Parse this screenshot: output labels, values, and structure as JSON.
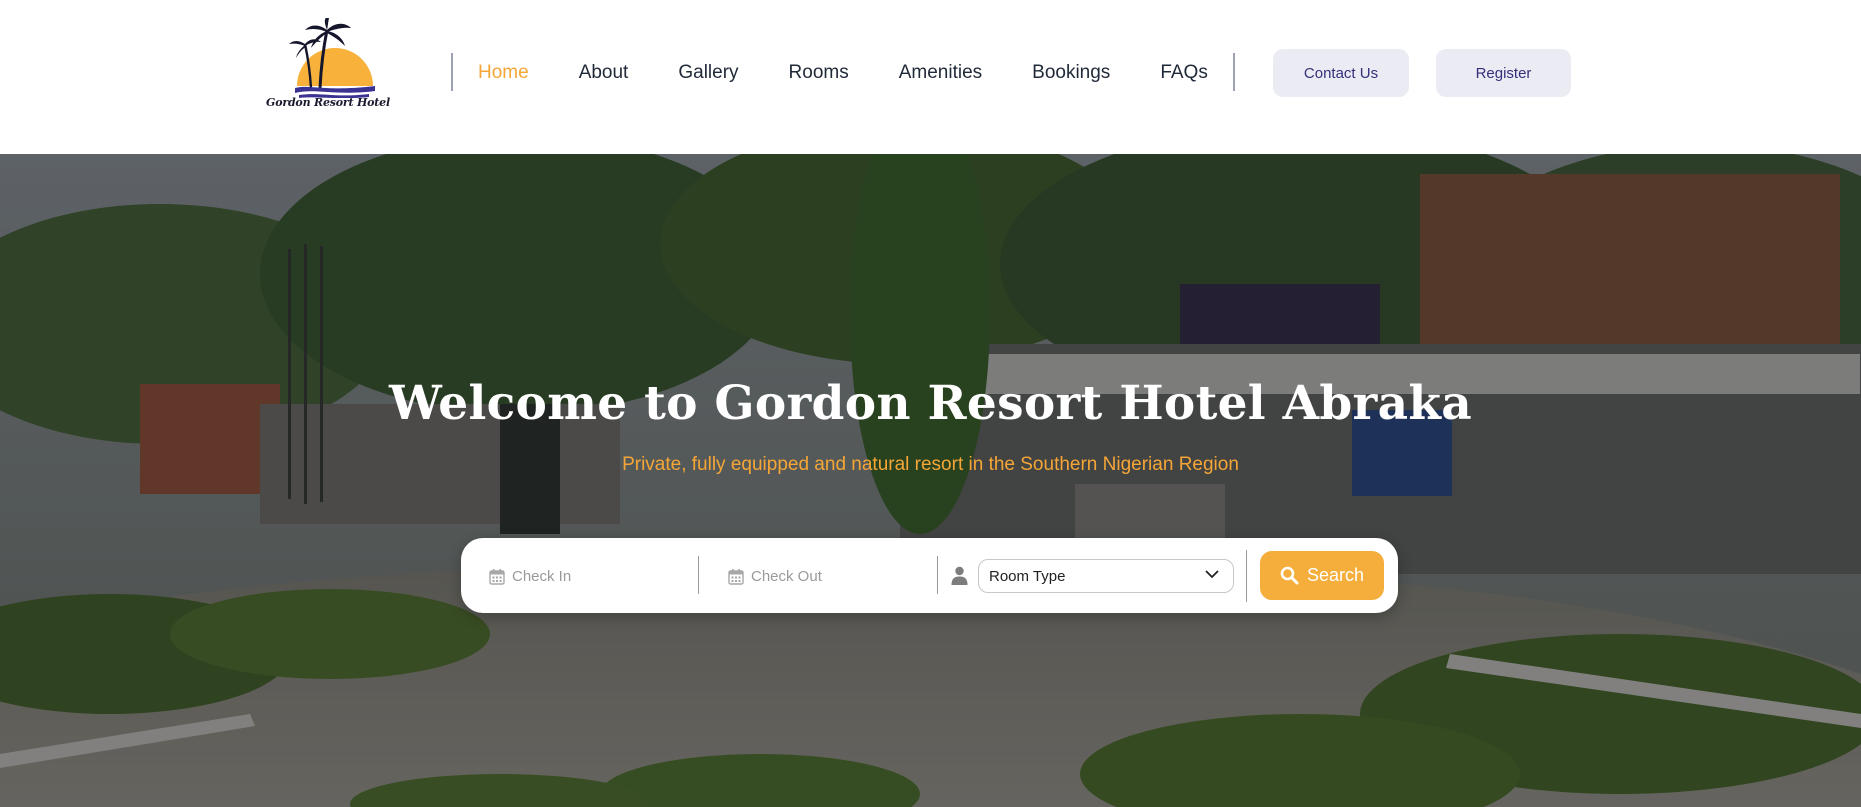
{
  "brand": {
    "name": "Gordon Resort Hotel",
    "accent": "#f5a636",
    "logo_sun": "#f8b13b",
    "logo_waves": "#3b3391",
    "logo_palm": "#15162b"
  },
  "nav": {
    "items": [
      {
        "label": "Home",
        "active": true
      },
      {
        "label": "About",
        "active": false
      },
      {
        "label": "Gallery",
        "active": false
      },
      {
        "label": "Rooms",
        "active": false
      },
      {
        "label": "Amenities",
        "active": false
      },
      {
        "label": "Bookings",
        "active": false
      },
      {
        "label": "FAQs",
        "active": false
      }
    ],
    "active_color": "#f5a636"
  },
  "header_buttons": {
    "contact": "Contact Us",
    "register": "Register",
    "bg": "#ebebf3",
    "text_color": "#33307a"
  },
  "hero": {
    "title": "Welcome to Gordon Resort Hotel Abraka",
    "subtitle": "Private, fully equipped and natural resort in the Southern Nigerian Region"
  },
  "search": {
    "check_in_placeholder": "Check In",
    "check_out_placeholder": "Check Out",
    "room_type_value": "Room Type",
    "button_label": "Search",
    "icons": [
      "calendar-icon",
      "calendar-icon",
      "user-icon",
      "chevron-down-icon",
      "search-icon"
    ],
    "button_color": "#f5ae3b"
  }
}
